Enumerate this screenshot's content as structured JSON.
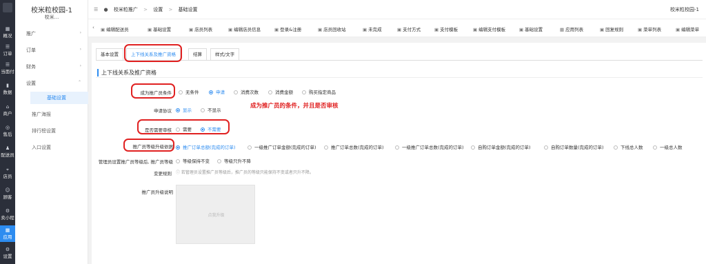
{
  "rail": [
    {
      "icon": "▦",
      "label": "概况"
    },
    {
      "icon": "☰",
      "label": "订单"
    },
    {
      "icon": "☰",
      "label": "当面付"
    },
    {
      "icon": "▮",
      "label": "数据"
    },
    {
      "icon": "⌂",
      "label": "商户"
    },
    {
      "icon": "◎",
      "label": "售后"
    },
    {
      "icon": "♟",
      "label": "配送员"
    },
    {
      "icon": "⌖",
      "label": "店员"
    },
    {
      "icon": "☺",
      "label": "顾客"
    },
    {
      "icon": "⚙",
      "label": "卖小程"
    },
    {
      "icon": "▦",
      "label": "应用"
    },
    {
      "icon": "⚙",
      "label": "设置"
    }
  ],
  "sidebar": {
    "title": "校米粒校园-1",
    "subtitle": "校米...",
    "groups": [
      "推广",
      "订单",
      "财务",
      "设置"
    ],
    "items": [
      "基础设置",
      "推广海报",
      "排行榜设置",
      "入口设置"
    ]
  },
  "header": {
    "breadcrumb": [
      "校米粒推广",
      ">",
      "设置",
      ">",
      "基础设置"
    ],
    "user": "校米粒校园-1"
  },
  "toolbar": {
    "arrow": "‹",
    "links": [
      "编辑配送员",
      "基础设置",
      "店员列表",
      "编辑店员信息",
      "登录&注册",
      "店员回收站",
      "未完成",
      "支付方式",
      "支付模板",
      "编辑支付模板",
      "基础设置",
      "应用列表",
      "回复规则",
      "菜单列表",
      "编辑菜单"
    ]
  },
  "tabs": [
    "基本设置",
    "上下线关系及推广资格",
    "结算",
    "样式/文字"
  ],
  "section_title": "上下线关系及推广资格",
  "form": {
    "condition": {
      "label": "成为推广员条件",
      "options": [
        "无条件",
        "申请",
        "消费次数",
        "消费金额",
        "购买指定商品"
      ],
      "selected": 1
    },
    "agreement": {
      "label": "申请协议",
      "options": [
        "显示",
        "不显示"
      ],
      "selected": 0
    },
    "review": {
      "label": "是否需要审核",
      "options": [
        "需要",
        "不需要"
      ],
      "selected": 1
    },
    "upgrade": {
      "label": "推广员等级升级依据",
      "options": [
        "推广订单总额(完成的订单)",
        "一级推广订单金额(完成的订单)",
        "推广订单总数(完成的订单)",
        "一级推广订单总数(完成的订单)",
        "自购订单金额(完成的订单)",
        "自购订单数量(完成的订单)",
        "下线总人数",
        "一级总人数"
      ],
      "selected": 0
    },
    "change_rule": {
      "label1": "管理员设置推广员等级后, 推广员等级",
      "label2": "变更规则",
      "options": [
        "等级保持不变",
        "等级只升不降"
      ],
      "hint": "若管理员设置推广员等级后，推广员的等级只能保持不变或者只升不降。"
    },
    "upgrade_desc": {
      "label": "推广员升级说明",
      "upload_text": "点我升级"
    }
  },
  "annotation": "成为推广员的条件，并且是否审核",
  "colors": {
    "accent": "#2d8cf0",
    "annotation_red": "#e02020",
    "rail_bg": "#2b2f3a"
  }
}
